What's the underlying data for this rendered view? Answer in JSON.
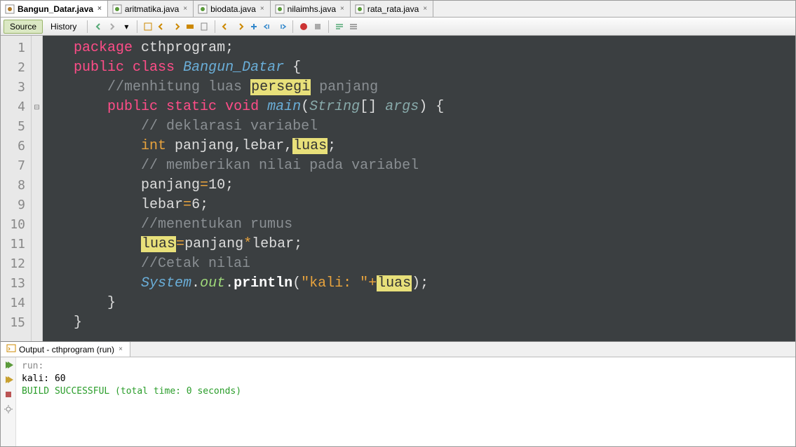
{
  "tabs": [
    {
      "label": "Bangun_Datar.java",
      "active": true
    },
    {
      "label": "aritmatika.java",
      "active": false
    },
    {
      "label": "biodata.java",
      "active": false
    },
    {
      "label": "nilaimhs.java",
      "active": false
    },
    {
      "label": "rata_rata.java",
      "active": false
    }
  ],
  "toolbar": {
    "source": "Source",
    "history": "History"
  },
  "gutter_lines": [
    "1",
    "2",
    "3",
    "4",
    "5",
    "6",
    "7",
    "8",
    "9",
    "10",
    "11",
    "12",
    "13",
    "14",
    "15"
  ],
  "code": {
    "l1_package": "package",
    "l1_pkgname": "cthprogram;",
    "l2_public": "public",
    "l2_class": "class",
    "l2_name": "Bangun_Datar",
    "l2_brace": "{",
    "l3_comment_a": "//menhitung luas ",
    "l3_hl": "persegi",
    "l3_comment_b": " panjang",
    "l4_public": "public",
    "l4_static": "static",
    "l4_void": "void",
    "l4_main": "main",
    "l4_paren": "(",
    "l4_string": "String",
    "l4_brk": "[]",
    "l4_args": "args",
    "l4_close": ") {",
    "l5_comment": "// deklarasi variabel",
    "l6_int": "int",
    "l6_vars_a": " panjang,lebar,",
    "l6_hl": "luas",
    "l6_semi": ";",
    "l7_comment": "// memberikan nilai pada variabel",
    "l8_a": "panjang",
    "l8_eq": "=",
    "l8_b": "10;",
    "l9_a": "lebar",
    "l9_eq": "=",
    "l9_b": "6;",
    "l10_comment": "//menentukan rumus",
    "l11_hl": "luas",
    "l11_eq": "=",
    "l11_a": "panjang",
    "l11_mul": "*",
    "l11_b": "lebar;",
    "l12_comment": "//Cetak nilai",
    "l13_sys": "System",
    "l13_dot1": ".",
    "l13_out": "out",
    "l13_dot2": ".",
    "l13_println": "println",
    "l13_open": "(",
    "l13_str": "\"kali: \"",
    "l13_plus": "+",
    "l13_hl": "luas",
    "l13_close": ");",
    "l14_brace": "}",
    "l15_brace": "}"
  },
  "output": {
    "tab_label": "Output - cthprogram (run)",
    "run": "run:",
    "result": "kali: 60",
    "build": "BUILD SUCCESSFUL (total time: 0 seconds)"
  }
}
